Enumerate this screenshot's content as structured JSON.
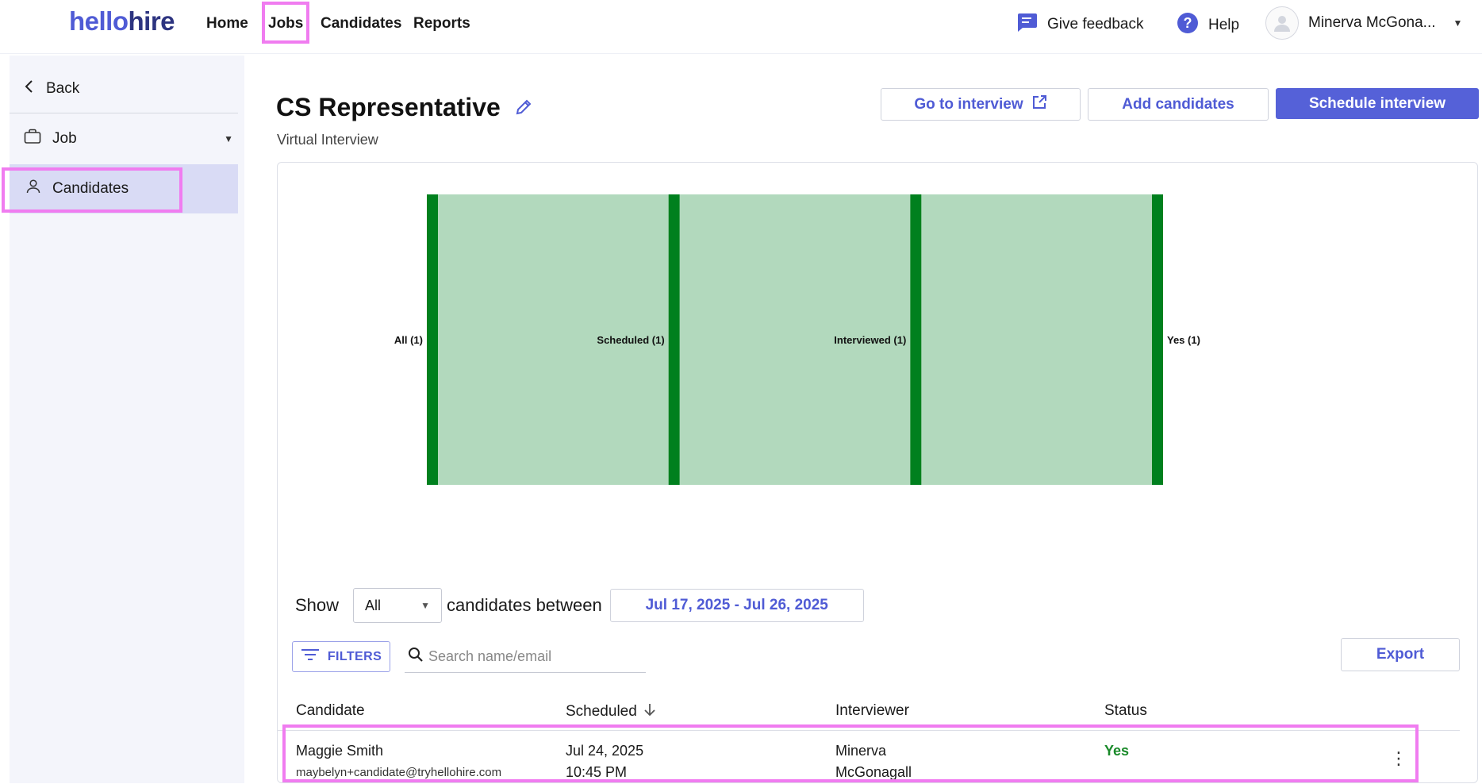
{
  "app": {
    "logo_part1": "hello",
    "logo_part2": "hire",
    "brand_color": "#4f5bd5",
    "highlight_color": "#f07cf0"
  },
  "nav": {
    "home": "Home",
    "jobs": "Jobs",
    "candidates": "Candidates",
    "reports": "Reports",
    "feedback": "Give feedback",
    "help": "Help",
    "user_name": "Minerva McGona..."
  },
  "sidebar": {
    "back": "Back",
    "job": "Job",
    "candidates": "Candidates"
  },
  "header": {
    "title": "CS Representative",
    "subtitle": "Virtual Interview",
    "go_to_interview": "Go to interview",
    "add_candidates": "Add candidates",
    "schedule_interview": "Schedule interview"
  },
  "chart_data": {
    "type": "sankey",
    "nodes": [
      "All (1)",
      "Scheduled (1)",
      "Interviewed (1)",
      "Yes (1)"
    ],
    "links": [
      {
        "source": "All (1)",
        "target": "Scheduled (1)",
        "value": 1
      },
      {
        "source": "Scheduled (1)",
        "target": "Interviewed (1)",
        "value": 1
      },
      {
        "source": "Interviewed (1)",
        "target": "Yes (1)",
        "value": 1
      }
    ],
    "node_color": "#00801e",
    "link_color": "#b2d9bd"
  },
  "controls": {
    "show_label": "Show",
    "show_value": "All",
    "between_label": "candidates between",
    "date_range": "Jul 17, 2025 - Jul 26, 2025",
    "filters": "FILTERS",
    "search_placeholder": "Search name/email",
    "export": "Export"
  },
  "table": {
    "columns": [
      "Candidate",
      "Scheduled",
      "Interviewer",
      "Status"
    ],
    "rows": [
      {
        "name": "Maggie Smith",
        "email": "maybelyn+candidate@tryhellohire.com",
        "date": "Jul 24, 2025",
        "time": "10:45 PM",
        "interviewer_first": "Minerva",
        "interviewer_last": "McGonagall",
        "status": "Yes"
      }
    ]
  }
}
